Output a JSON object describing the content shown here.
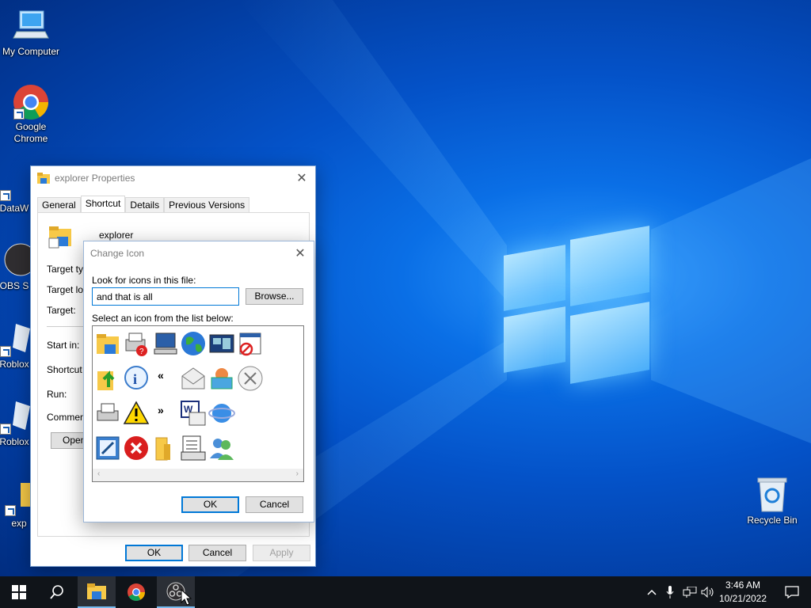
{
  "desktop": {
    "icons": [
      {
        "label": "My Computer"
      },
      {
        "label": "Google Chrome"
      },
      {
        "label": "DataW"
      },
      {
        "label": "OBS S"
      },
      {
        "label": "Roblox"
      },
      {
        "label": "Roblox"
      },
      {
        "label": "exp"
      },
      {
        "label": "Recycle Bin"
      }
    ]
  },
  "properties_window": {
    "title": "explorer Properties",
    "tabs": [
      "General",
      "Shortcut",
      "Details",
      "Previous Versions"
    ],
    "active_tab": "Shortcut",
    "name": "explorer",
    "fields": {
      "target_type": "Target typ",
      "target_location": "Target loc",
      "target": "Target:",
      "start_in": "Start in:",
      "shortcut_key": "Shortcut k",
      "run": "Run:",
      "comment": "Comment:"
    },
    "open_button": "Open",
    "buttons": {
      "ok": "OK",
      "cancel": "Cancel",
      "apply": "Apply"
    }
  },
  "change_icon_dialog": {
    "title": "Change Icon",
    "file_label": "Look for icons in this file:",
    "file_value": "and that is all",
    "browse_button": "Browse...",
    "list_label": "Select an icon from the list below:",
    "icons": [
      "folder-icon",
      "printer-help-icon",
      "computer-icon",
      "globe-icon",
      "windows-icon",
      "blocked-window-icon",
      "folder-up-icon",
      "info-icon",
      "rewind-icon",
      "mail-icon",
      "basket-icon",
      "cancel-circle-icon",
      "printer-icon",
      "warning-icon",
      "fast-forward-icon",
      "document-icon",
      "ie-globe-icon",
      "edit-icon",
      "error-icon",
      "folder-closed-icon",
      "properties-icon",
      "users-icon"
    ],
    "buttons": {
      "ok": "OK",
      "cancel": "Cancel"
    }
  },
  "taskbar": {
    "time": "3:46 AM",
    "date": "10/21/2022"
  }
}
